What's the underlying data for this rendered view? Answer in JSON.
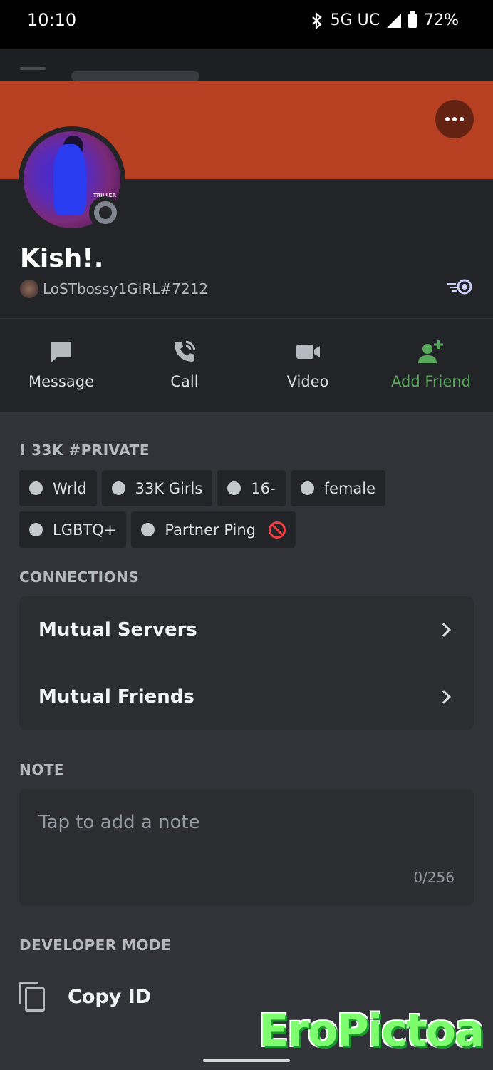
{
  "status_bar": {
    "time": "10:10",
    "network": "5G UC",
    "battery": "72%",
    "icons": [
      "bluetooth-icon",
      "signal-icon",
      "battery-icon"
    ]
  },
  "colors": {
    "banner": "#b73f22",
    "sheet": "#313338",
    "header": "#232428",
    "accent_green": "#57a85a",
    "role_dot": "#c4c9ce",
    "offline_status": "#80848e"
  },
  "profile": {
    "display_name": "Kish!.",
    "username": "LoSTbossy1GiRL#7212",
    "avatar_watermark": "TRILLER"
  },
  "actions": [
    {
      "label": "Message",
      "icon": "message-icon"
    },
    {
      "label": "Call",
      "icon": "phone-icon"
    },
    {
      "label": "Video",
      "icon": "video-camera-icon"
    },
    {
      "label": "Add Friend",
      "icon": "add-friend-icon"
    }
  ],
  "about": {
    "title": "! 33K #PRIVATE",
    "roles": [
      {
        "label": "Wrld"
      },
      {
        "label": "33K Girls"
      },
      {
        "label": "16-"
      },
      {
        "label": "female"
      },
      {
        "label": "LGBTQ+"
      },
      {
        "label": "Partner Ping"
      }
    ]
  },
  "connections": {
    "title": "CONNECTIONS",
    "items": [
      {
        "label": "Mutual Servers"
      },
      {
        "label": "Mutual Friends"
      }
    ]
  },
  "note": {
    "title": "NOTE",
    "placeholder": "Tap to add a note",
    "counter": "0/256"
  },
  "developer": {
    "title": "DEVELOPER MODE",
    "copy_id": "Copy ID"
  },
  "watermark": "EroPictoa"
}
